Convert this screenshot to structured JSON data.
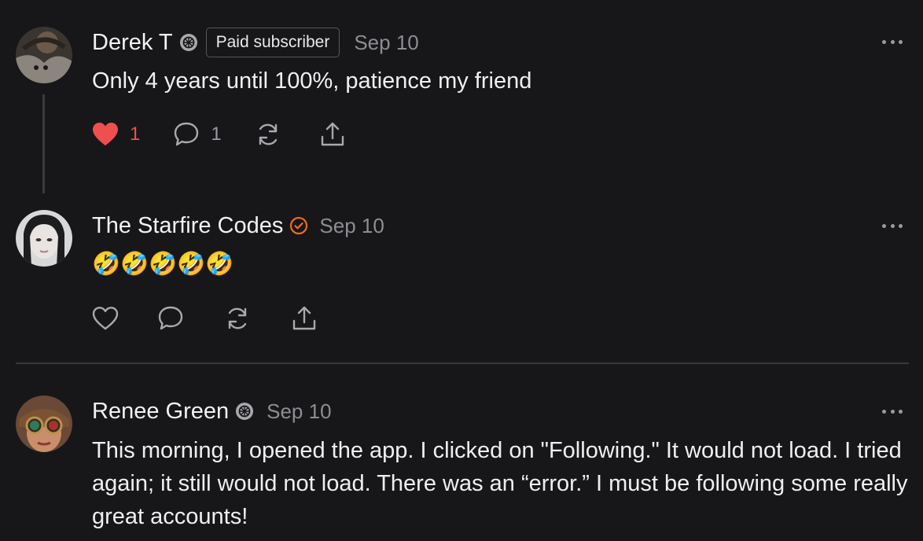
{
  "comments": [
    {
      "author": "Derek T",
      "badge_icon": "subscriber-seal-icon",
      "pill": "Paid subscriber",
      "date": "Sep 10",
      "text": "Only 4 years until 100%, patience my friend",
      "likes": "1",
      "replies": "1",
      "liked": true
    },
    {
      "author": "The Starfire Codes",
      "badge_icon": "verified-check-icon",
      "date": "Sep 10",
      "text": "🤣🤣🤣🤣🤣"
    },
    {
      "author": "Renee Green",
      "badge_icon": "subscriber-seal-icon",
      "date": "Sep 10",
      "text": "This morning, I opened the app. I clicked on \"Following.\" It would not load. I tried again; it still would not load. There was an “error.” I must be following some really great accounts!"
    }
  ],
  "colors": {
    "background": "#17171a",
    "like_red": "#f04f4f",
    "verified_orange": "#f26b1d",
    "muted": "#8d8d92"
  }
}
